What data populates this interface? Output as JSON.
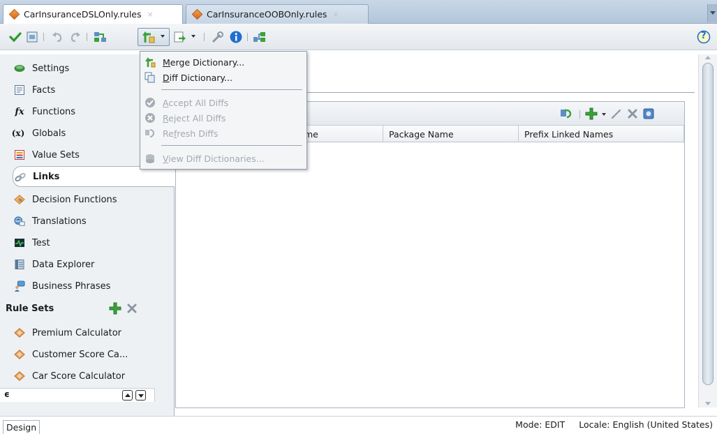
{
  "tabs": [
    {
      "label": "CarInsuranceDSLOnly.rules",
      "active": true
    },
    {
      "label": "CarInsuranceOOBOnly.rules",
      "active": false
    }
  ],
  "tab_close_glyph": "×",
  "toolbar": {
    "icons": [
      "validate-check-icon",
      "dictionary-icon",
      "undo-icon",
      "redo-icon",
      "link-dictionary-icon",
      "merge-dictionary-icon",
      "export-icon",
      "settings-wrench-icon",
      "info-icon",
      "dictionary-link-icon",
      "help-icon"
    ],
    "help_label": "?"
  },
  "nav": {
    "items": [
      {
        "label": "Settings",
        "icon": "settings-icon"
      },
      {
        "label": "Facts",
        "icon": "facts-icon"
      },
      {
        "label": "Functions",
        "icon": "functions-icon",
        "glyph": "fx"
      },
      {
        "label": "Globals",
        "icon": "globals-icon",
        "glyph": "(x)"
      },
      {
        "label": "Value Sets",
        "icon": "value-sets-icon"
      },
      {
        "label": "Links",
        "icon": "links-icon",
        "selected": true
      },
      {
        "label": "Decision Functions",
        "icon": "decision-functions-icon"
      },
      {
        "label": "Translations",
        "icon": "translations-icon"
      },
      {
        "label": "Test",
        "icon": "test-icon"
      },
      {
        "label": "Data Explorer",
        "icon": "data-explorer-icon"
      },
      {
        "label": "Business Phrases",
        "icon": "business-phrases-icon"
      }
    ],
    "rule_sets_header": "Rule Sets",
    "rule_sets": [
      {
        "label": "Premium Calculator"
      },
      {
        "label": "Customer Score Ca..."
      },
      {
        "label": "Car Score Calculator"
      }
    ],
    "collapse_glyph": "ϵ"
  },
  "links_table": {
    "columns": [
      "me",
      "Package Name",
      "Prefix Linked Names"
    ]
  },
  "menu": {
    "items": [
      {
        "label": "Merge Dictionary...",
        "mnemonic_index": 0,
        "enabled": true,
        "icon": "merge-dictionary-icon"
      },
      {
        "label": "Diff Dictionary...",
        "mnemonic_index": 0,
        "enabled": true,
        "icon": "diff-dictionary-icon"
      },
      {
        "label": "Accept All Diffs",
        "mnemonic_index": 0,
        "enabled": false,
        "icon": "accept-check-icon"
      },
      {
        "label": "Reject All Diffs",
        "mnemonic_index": 0,
        "enabled": false,
        "icon": "reject-x-icon"
      },
      {
        "label": "Refresh Diffs",
        "mnemonic_index": 2,
        "enabled": false,
        "icon": "refresh-icon"
      },
      {
        "label": "View Diff Dictionaries...",
        "mnemonic_index": 0,
        "enabled": false,
        "icon": "view-diff-icon"
      }
    ]
  },
  "status": {
    "mode": "Mode: EDIT",
    "locale": "Locale: English (United States)"
  },
  "bottom_tab": "Design",
  "colors": {
    "accent_green": "#3aa23a",
    "delete_gray": "#8c96a0",
    "help_blue": "#1f6fcf"
  }
}
